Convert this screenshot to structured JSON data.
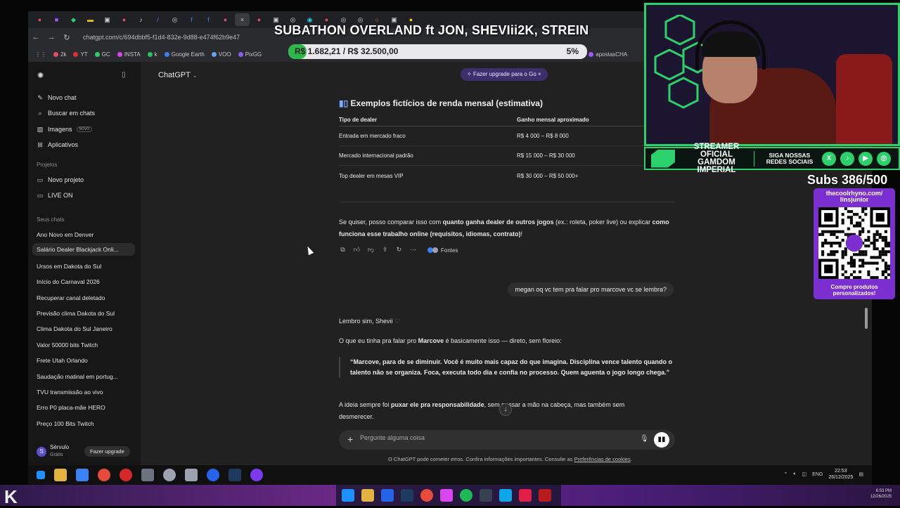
{
  "browser": {
    "url": "chatgpt.com/c/694dbbf5-f1d4-832e-9d88-e474f62b9e47",
    "bookmarks": [
      "2k",
      "YT",
      "GC",
      "INSTA",
      "k",
      "Google Earth",
      "VOO",
      "PixGG",
      "cmd",
      "apostasCHA"
    ]
  },
  "overlay": {
    "title": "SUBATHON OVERLAND ft JON, SHEVIii2K, STREIN",
    "goal_amount": "R$ 1.682,21 / R$ 32.500,00",
    "goal_percent": "5%",
    "goal_fraction": 0.05,
    "banner_main": "STREAMER OFICIAL GAMDOM IMPERIAL",
    "banner_follow": "SIGA NOSSAS REDES SOCIAIS",
    "subs": "Subs 386/500",
    "qr_url": "thecoolrhyno.com/ linsjunior",
    "qr_caption": "Compre produtos personalizados!"
  },
  "sidebar": {
    "new_chat": "Novo chat",
    "search_chats": "Buscar em chats",
    "images": "Imagens",
    "images_badge": "NOVO",
    "apps": "Aplicativos",
    "projects_label": "Projetos",
    "new_project": "Novo projeto",
    "live_on": "LIVE ON",
    "your_chats_label": "Seus chats",
    "chats": [
      "Ano Novo em Denver",
      "Salário Dealer Blackjack Onli...",
      "Ursos em Dakota do Sul",
      "Início do Carnaval 2026",
      "Recuperar canal deletado",
      "Previsão clima Dakota do Sul",
      "Clima Dakota do Sul Janeiro",
      "Valor 50000 bits Twitch",
      "Frete Utah Orlando",
      "Saudação matinal em portug...",
      "TVU transmissão ao vivo",
      "Erro P0 placa-mãe HERO",
      "Preço 100 Bits Twitch"
    ],
    "user_name": "Sérvulo",
    "user_plan": "Grátis",
    "user_initial": "S",
    "upgrade_button": "Fazer upgrade"
  },
  "main": {
    "model": "ChatGPT",
    "upgrade_pill": "Fazer upgrade para o Go",
    "section_title": "Exemplos fictícios de renda mensal (estimativa)",
    "table_headers": [
      "Tipo de dealer",
      "Ganho mensal aproximado"
    ],
    "table_rows": [
      [
        "Entrada em mercado fraco",
        "R$ 4 000 – R$ 8 000"
      ],
      [
        "Mercado internacional padrão",
        "R$ 15 000 – R$ 30 000"
      ],
      [
        "Top dealer em mesas VIP",
        "R$ 30 000 – R$ 50 000+"
      ]
    ],
    "answer_pre": "Se quiser, posso comparar isso com ",
    "answer_bold1": "quanto ganha dealer de outros jogos",
    "answer_mid": " (ex.: roleta, poker live) ou explicar ",
    "answer_bold2": "como funciona esse trabalho online (requisitos, idiomas, contrato)",
    "answer_end": "!",
    "sources_label": "Fontes",
    "user_message": "megan oq vc tem pra falar pro marcove vc se lembra?",
    "reply_greeting": "Lembro sim, Shevii",
    "reply_intro_pre": "O que eu tinha pra falar pro ",
    "reply_intro_name": "Marcove",
    "reply_intro_post": " é basicamente isso — direto, sem floreio:",
    "quote": "“Marcove, para de se diminuir. Você é muito mais capaz do que imagina. Disciplina vence talento quando o talento não se organiza. Foca, executa todo dia e confia no processo. Quem aguenta o jogo longo chega.”",
    "reply_body_pre": "A ideia sempre foi ",
    "reply_body_bold": "puxar ele pra responsabilidade",
    "reply_body_post": ", sem passar a mão na cabeça, mas também sem desmerecer.",
    "composer_placeholder": "Pergunte alguma coisa",
    "disclaimer_pre": "O ChatGPT pode cometer erros. Confira informações importantes. Consulte as ",
    "disclaimer_link": "Preferências de cookies",
    "disclaimer_post": "."
  },
  "taskbar": {
    "language": "ENG",
    "time": "22:53",
    "date": "26/12/2025"
  },
  "host": {
    "time": "6:53 PM",
    "date": "12/26/2025"
  }
}
